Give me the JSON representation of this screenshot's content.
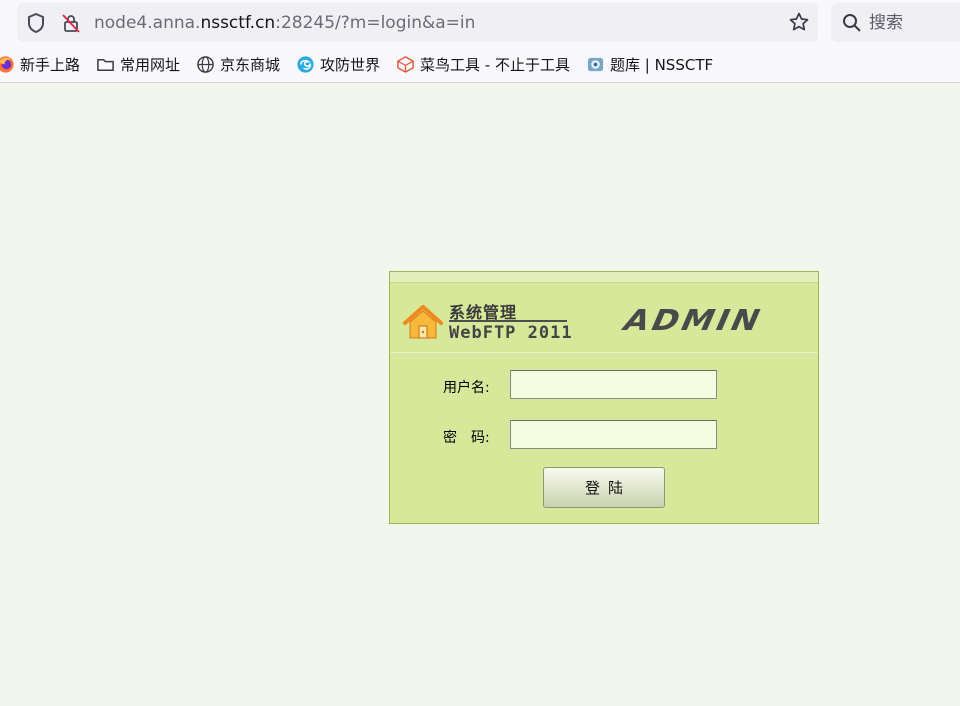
{
  "browser": {
    "url_prefix": "node4.anna.",
    "url_host": "nssctf.cn",
    "url_suffix": ":28245/?m=login&a=in",
    "search_placeholder": "搜索"
  },
  "bookmarks": [
    {
      "label": "新手上路",
      "icon": "firefox-icon"
    },
    {
      "label": "常用网址",
      "icon": "folder-icon"
    },
    {
      "label": "京东商城",
      "icon": "globe-icon"
    },
    {
      "label": "攻防世界",
      "icon": "swirl-icon"
    },
    {
      "label": "菜鸟工具 - 不止于工具",
      "icon": "cube-icon"
    },
    {
      "label": "题库 | NSSCTF",
      "icon": "nssctf-icon"
    }
  ],
  "login": {
    "title": "系统管理",
    "subtitle": "WebFTP 2011",
    "logo_text": "ADMIN",
    "username_label": "用户名:",
    "password_label": "密　码:",
    "username_value": "",
    "password_value": "",
    "submit_label": "登陆"
  },
  "colors": {
    "page_bg": "#f3f6ec",
    "panel_bg": "#d8e89a",
    "input_bg": "#f4fde0"
  }
}
